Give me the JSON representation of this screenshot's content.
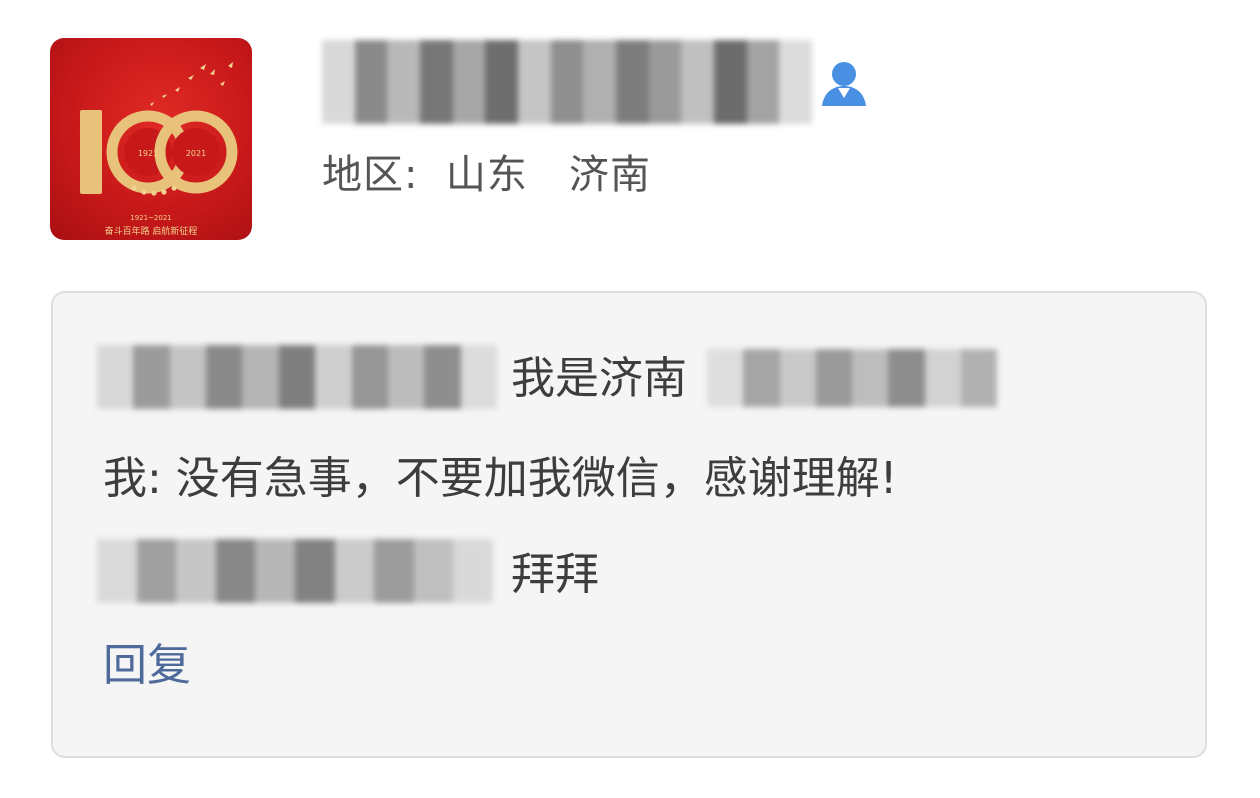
{
  "contact": {
    "avatar_icon": "centenary-100-logo-icon",
    "avatar_years": "1921  2021",
    "avatar_range": "1921~2021",
    "avatar_slogan": "奋斗百年路 启航新征程",
    "contact_icon": "person-icon",
    "region": "地区:  山东   济南"
  },
  "message": {
    "line1_visible": "我是济南",
    "line2": "我: 没有急事，不要加我微信，感谢理解!",
    "line3_visible": "拜拜",
    "reply_label": "回复"
  },
  "colors": {
    "avatar_red": "#c8191a",
    "gold": "#e8c27a",
    "link_blue": "#4d6a9a",
    "contact_icon_blue": "#4a90e2"
  }
}
